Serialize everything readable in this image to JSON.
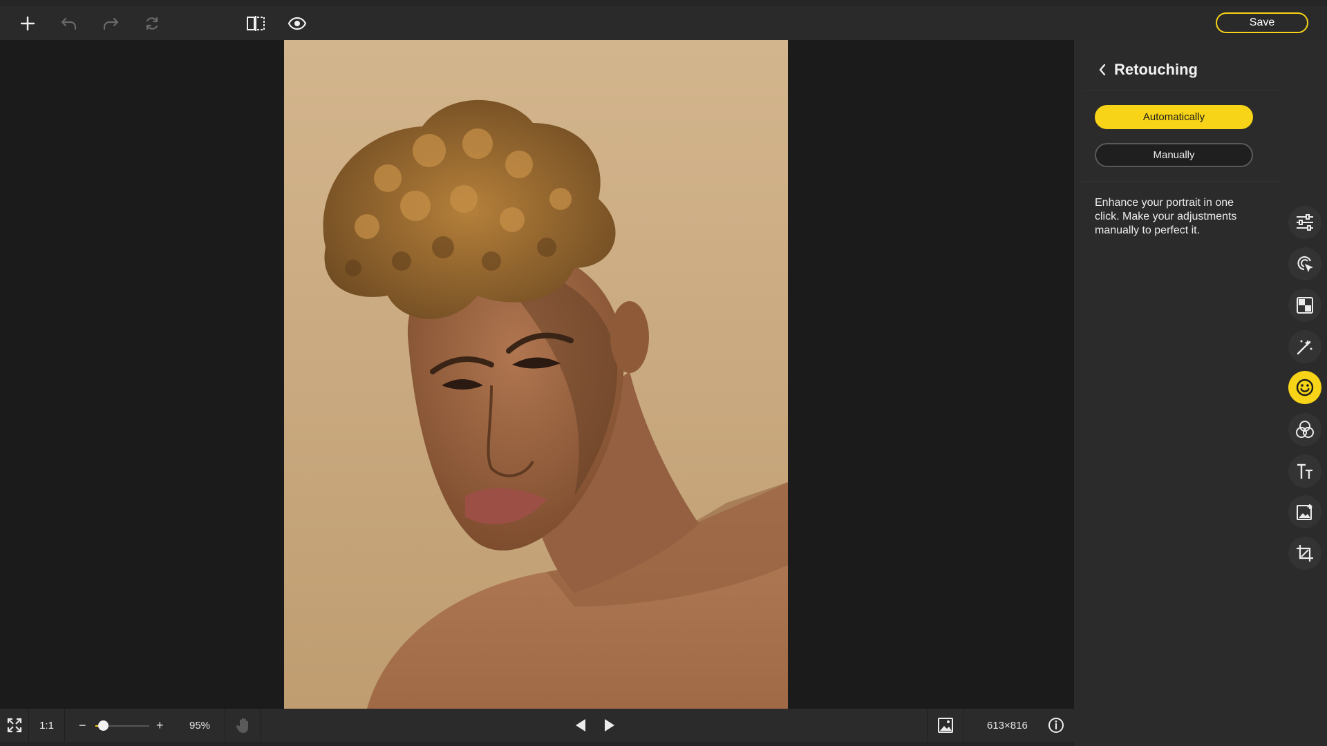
{
  "toolbar": {
    "save_label": "Save",
    "left_icons": [
      "plus-icon",
      "undo-icon",
      "redo-icon",
      "reset-icon",
      "compare-split-icon",
      "preview-eye-icon"
    ],
    "accent_color": "#f7d417"
  },
  "panel": {
    "title": "Retouching",
    "options": {
      "auto_label": "Automatically",
      "manual_label": "Manually",
      "selected": "Automatically"
    },
    "description": "Enhance your portrait in one click. Make your adjustments manually to perfect it."
  },
  "tool_rail": {
    "icons": [
      "adjust-sliders-icon",
      "select-object-icon",
      "layers-icon",
      "magic-wand-icon",
      "retouch-face-icon",
      "color-filters-icon",
      "text-icon",
      "image-insert-icon",
      "crop-icon"
    ],
    "active": "retouch-face-icon"
  },
  "bottombar": {
    "ratio_label": "1:1",
    "minus_label": "−",
    "plus_label": "+",
    "zoom_percent": "95%",
    "zoom_level": 0.14,
    "dimensions": "613×816"
  },
  "photo": {
    "background_color": "#c9a97e",
    "subject": "portrait"
  }
}
